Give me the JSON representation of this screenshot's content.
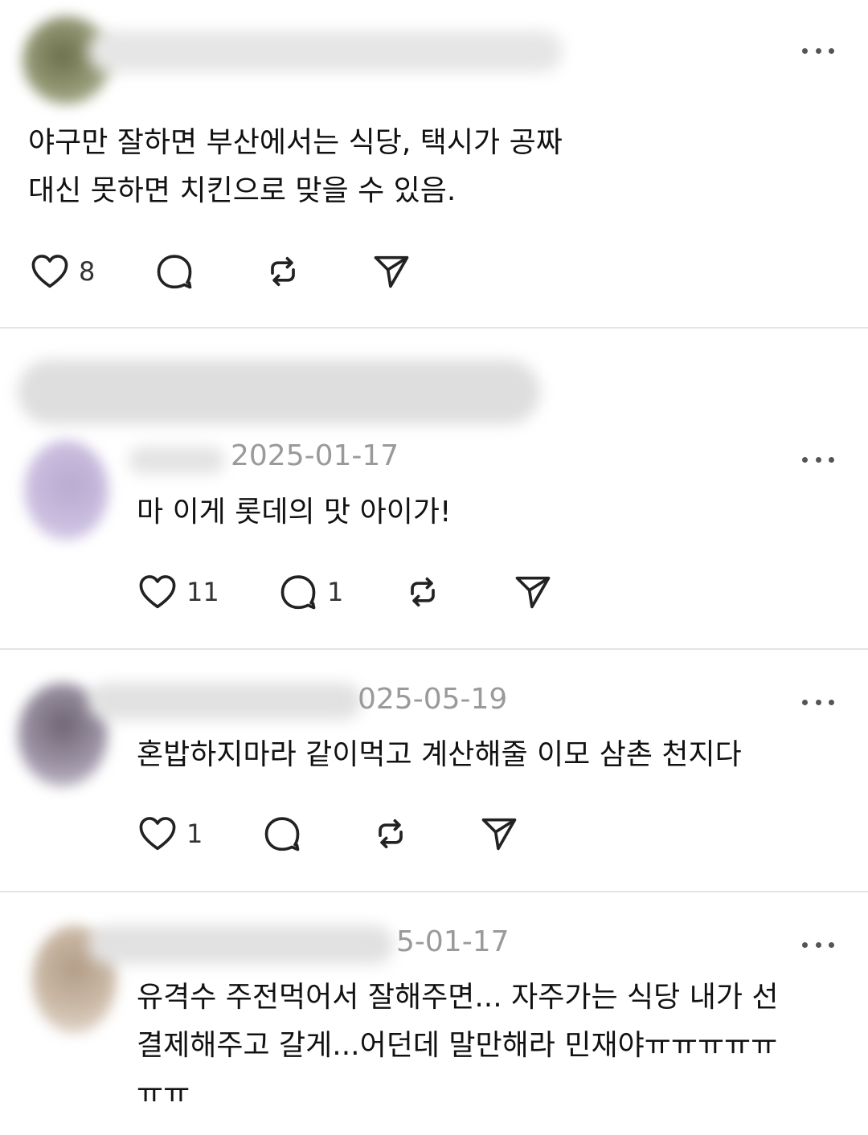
{
  "posts": [
    {
      "date": "",
      "text": "야구만 잘하면 부산에서는 식당, 택시가 공짜\n대신 못하면 치킨으로 맞을 수 있음.",
      "likes": "8",
      "comments": ""
    },
    {
      "date": "2025-01-17",
      "text": "마 이게 롯데의 맛 아이가!",
      "likes": "11",
      "comments": "1"
    },
    {
      "date": "025-05-19",
      "text": "혼밥하지마라 같이먹고 계산해줄 이모 삼촌 천지다",
      "likes": "1",
      "comments": ""
    },
    {
      "date": "5-01-17",
      "text": "유격수 주전먹어서 잘해주면... 자주가는 식당 내가 선\n결제해주고 갈게...어던데 말만해라 민재야ㅠㅠㅠㅠㅠ\nㅠㅠ",
      "likes": "",
      "comments": ""
    }
  ],
  "icons": {
    "like": "heart-icon",
    "comment": "comment-bubble-icon",
    "repost": "repost-icon",
    "share": "send-icon",
    "more": "more-options-icon"
  },
  "colors": {
    "text": "#111111",
    "muted": "#9a9a9a",
    "icon": "#222222",
    "divider": "#e4e4e4"
  }
}
